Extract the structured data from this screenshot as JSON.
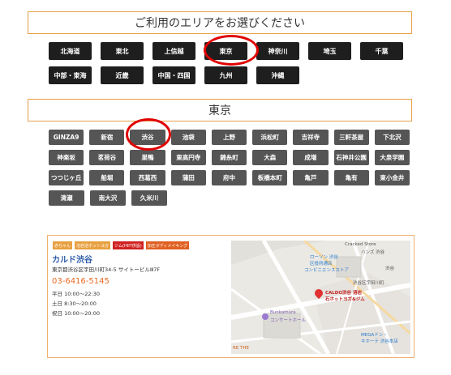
{
  "area_select": {
    "heading": "ご利用のエリアをお選びください",
    "row1": [
      "北海道",
      "東北",
      "上信越",
      "東京",
      "神奈川",
      "埼玉",
      "千葉"
    ],
    "row2": [
      "中部・東海",
      "近畿",
      "中国・四国",
      "九州",
      "沖縄"
    ]
  },
  "tokyo": {
    "heading": "東京",
    "rows": [
      [
        "GINZA9",
        "新宿",
        "渋谷",
        "池袋",
        "上野",
        "浜松町",
        "吉祥寺",
        "三軒茶屋",
        "下北沢"
      ],
      [
        "神楽坂",
        "茗荷谷",
        "巣鴨",
        "東高円寺",
        "錦糸町",
        "大森",
        "成増",
        "石神井公園",
        "大泉学園"
      ],
      [
        "つつじヶ丘",
        "船堀",
        "西葛西",
        "蒲田",
        "府中",
        "板橋本町",
        "亀戸",
        "亀有",
        "東小金井"
      ],
      [
        "清瀬",
        "南大沢",
        "久米川"
      ]
    ]
  },
  "store": {
    "tags": [
      {
        "label": "赤ちゃん",
        "color": "#e8a040"
      },
      {
        "label": "溶岩浴ホットヨガ",
        "color": "#e8a040"
      },
      {
        "label": "ジム(HIIT併設)",
        "color": "#d02020"
      },
      {
        "label": "加圧ボディメイキング",
        "color": "#e06020"
      }
    ],
    "name": "カルド渋谷",
    "address": "東京都渋谷区宇田川町34-5 サイトービルⅢ7F",
    "tel": "03-6416-5145",
    "hours": [
      "平日 10:00〜22:30",
      "土日 8:30〜20:00",
      "祝日 10:00〜20:00"
    ],
    "map_labels": {
      "cracked": "Cracked Store",
      "hands": "ハンズ 渋谷",
      "lawson": "ローソン 渋谷",
      "lawson2": "区役所通店",
      "convenience": "コンビニエンスストア",
      "udagawa": "渋谷区宇田川町",
      "pin": "CALDO渋谷 溶岩",
      "pin2": "石ホットヨガ&ジム",
      "bunkamura": "Bunkamura",
      "bunkamura2": "コンサートホール",
      "mega": "MEGAドン・",
      "mega2": "キホーテ 渋谷本店",
      "the": "RE THE",
      "shibuya": "渋谷"
    }
  }
}
